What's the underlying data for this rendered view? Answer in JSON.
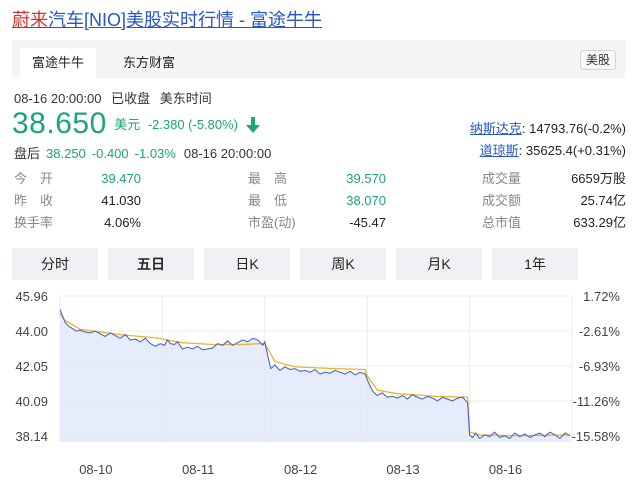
{
  "title": {
    "highlight": "蔚来",
    "rest": "汽车[NIO]美股实时行情 - 富途牛牛"
  },
  "source_tabs": [
    {
      "label": "富途牛牛",
      "active": true
    },
    {
      "label": "东方财富",
      "active": false
    }
  ],
  "market_badge": "美股",
  "meta": {
    "datetime": "08-16 20:00:00",
    "status": "已收盘",
    "timezone": "美东时间"
  },
  "quote": {
    "price": "38.650",
    "currency": "美元",
    "change": "-2.380 (-5.80%)",
    "direction_icon": "arrow-down-icon",
    "color": "#1ba579"
  },
  "after_hours": {
    "label": "盘后",
    "price": "38.250",
    "change": "-0.400",
    "pct": "-1.03%",
    "time": "08-16 20:00:00"
  },
  "indices": [
    {
      "name": "纳斯达克",
      "value": ": 14793.76(-0.2%)"
    },
    {
      "name": "道琼斯",
      "value": ": 35625.4(+0.31%)"
    }
  ],
  "stats": [
    [
      {
        "label": "今　开",
        "value": "39.470",
        "tone": "green"
      },
      {
        "label": "最　高",
        "value": "39.570",
        "tone": "green"
      },
      {
        "label": "成交量",
        "value": "6659万股",
        "tone": "dark"
      }
    ],
    [
      {
        "label": "昨　收",
        "value": "41.030",
        "tone": "dark"
      },
      {
        "label": "最　低",
        "value": "38.070",
        "tone": "green"
      },
      {
        "label": "成交额",
        "value": "25.74亿",
        "tone": "dark"
      }
    ],
    [
      {
        "label": "换手率",
        "value": "4.06%",
        "tone": "dark"
      },
      {
        "label": "市盈(动)",
        "value": "-45.47",
        "tone": "dark"
      },
      {
        "label": "总市值",
        "value": "633.29亿",
        "tone": "dark"
      }
    ]
  ],
  "period_tabs": [
    {
      "label": "分时",
      "active": false
    },
    {
      "label": "五日",
      "active": true
    },
    {
      "label": "日K",
      "active": false
    },
    {
      "label": "周K",
      "active": false
    },
    {
      "label": "月K",
      "active": false
    },
    {
      "label": "1年",
      "active": false
    }
  ],
  "chart_data": {
    "type": "line",
    "title": "",
    "y_ticks": [
      "45.96",
      "44.00",
      "42.05",
      "40.09",
      "38.14"
    ],
    "y_tick_values": [
      45.96,
      44.0,
      42.05,
      40.09,
      38.14
    ],
    "y_pct_ticks": [
      "1.72%",
      "-2.61%",
      "-6.93%",
      "-11.26%",
      "-15.58%"
    ],
    "ylim": [
      37.8,
      45.96
    ],
    "x_ticks": [
      "08-10",
      "08-11",
      "08-12",
      "08-13",
      "08-16"
    ],
    "prev_close": 41.03,
    "grid": true,
    "colors": {
      "price": "#4a68c9",
      "average": "#f2b227",
      "fill": "#dfe6f9"
    },
    "series": [
      {
        "role": "price",
        "day_x": [
          0,
          0.02,
          0.05,
          0.08,
          0.12,
          0.16,
          0.2,
          0.25,
          0.3,
          0.35,
          0.4,
          0.45,
          0.5,
          0.55,
          0.6,
          0.65,
          0.7,
          0.75,
          0.8,
          0.85,
          0.9,
          0.95,
          1,
          1,
          0.02,
          0.05,
          0.08,
          0.12,
          0.15,
          0.2,
          0.25,
          0.3,
          0.35,
          0.4,
          0.45,
          0.5,
          0.55,
          0.6,
          0.65,
          0.7,
          0.75,
          0.8,
          0.85,
          0.9,
          0.95,
          1,
          0,
          0.03,
          0.06,
          0.1,
          0.15,
          0.2,
          0.25,
          0.3,
          0.35,
          0.4,
          0.45,
          0.5,
          0.55,
          0.6,
          0.65,
          0.7,
          0.75,
          0.8,
          0.85,
          0.9,
          0.95,
          1,
          0,
          0.03,
          0.06,
          0.1,
          0.15,
          0.2,
          0.25,
          0.3,
          0.35,
          0.4,
          0.45,
          0.5,
          0.55,
          0.6,
          0.65,
          0.7,
          0.75,
          0.8,
          0.85,
          0.9,
          0.95,
          1,
          0,
          0.03,
          0.06,
          0.1,
          0.15,
          0.2,
          0.25,
          0.3,
          0.35,
          0.4,
          0.45,
          0.5,
          0.55,
          0.6,
          0.65,
          0.7,
          0.75,
          0.8,
          0.85,
          0.9,
          0.95,
          1
        ],
        "day_index": [
          0,
          0,
          0,
          0,
          0,
          0,
          0,
          0,
          0,
          0,
          0,
          0,
          0,
          0,
          0,
          0,
          0,
          0,
          0,
          0,
          0,
          0,
          0,
          0,
          1,
          1,
          1,
          1,
          1,
          1,
          1,
          1,
          1,
          1,
          1,
          1,
          1,
          1,
          1,
          1,
          1,
          1,
          1,
          1,
          1,
          1,
          2,
          2,
          2,
          2,
          2,
          2,
          2,
          2,
          2,
          2,
          2,
          2,
          2,
          2,
          2,
          2,
          2,
          2,
          2,
          2,
          2,
          2,
          3,
          3,
          3,
          3,
          3,
          3,
          3,
          3,
          3,
          3,
          3,
          3,
          3,
          3,
          3,
          3,
          3,
          3,
          3,
          3,
          3,
          3,
          4,
          4,
          4,
          4,
          4,
          4,
          4,
          4,
          4,
          4,
          4,
          4,
          4,
          4,
          4,
          4,
          4,
          4,
          4,
          4,
          4,
          4
        ],
        "values": [
          45.2,
          44.9,
          44.5,
          44.3,
          44.15,
          44.0,
          44.05,
          43.95,
          43.9,
          44.0,
          43.85,
          43.7,
          43.9,
          43.75,
          43.6,
          43.8,
          43.5,
          43.55,
          43.4,
          43.6,
          43.3,
          43.15,
          43.3,
          43.3,
          43.2,
          43.5,
          43.3,
          43.25,
          43.4,
          43.0,
          43.1,
          43.0,
          43.15,
          42.95,
          43.0,
          43.05,
          43.3,
          43.2,
          43.45,
          43.2,
          43.35,
          43.5,
          43.4,
          43.6,
          43.5,
          43.2,
          43.4,
          42.6,
          41.9,
          42.1,
          41.8,
          42.0,
          41.85,
          41.9,
          41.75,
          41.8,
          41.7,
          41.85,
          41.6,
          41.7,
          41.65,
          41.8,
          41.7,
          41.6,
          41.75,
          41.55,
          41.7,
          41.6,
          41.3,
          40.9,
          40.6,
          40.4,
          40.55,
          40.3,
          40.35,
          40.25,
          40.4,
          40.2,
          40.45,
          40.3,
          40.2,
          40.35,
          40.25,
          40.1,
          40.3,
          40.2,
          40.1,
          40.25,
          40.3,
          40.0,
          38.2,
          38.05,
          38.3,
          38.0,
          38.2,
          38.1,
          38.35,
          38.05,
          38.15,
          38.0,
          38.3,
          38.1,
          38.25,
          38.05,
          38.2,
          38.3,
          38.1,
          38.35,
          38.2,
          38.0,
          38.3,
          38.15
        ]
      },
      {
        "role": "average",
        "day_index": [
          0,
          0,
          0,
          0,
          0,
          1,
          1,
          1,
          1,
          1,
          2,
          2,
          2,
          2,
          2,
          3,
          3,
          3,
          3,
          3,
          4,
          4,
          4,
          4
        ],
        "day_x": [
          0,
          0.05,
          0.2,
          0.6,
          1,
          0,
          0.2,
          0.5,
          0.8,
          1,
          0,
          0.1,
          0.3,
          0.7,
          1,
          0,
          0.1,
          0.3,
          0.7,
          1,
          0,
          0.1,
          0.5,
          1
        ],
        "values": [
          45.0,
          44.6,
          44.1,
          43.8,
          43.6,
          43.55,
          43.35,
          43.25,
          43.25,
          43.3,
          43.3,
          42.3,
          42.0,
          41.9,
          41.85,
          41.5,
          40.7,
          40.5,
          40.35,
          40.3,
          38.35,
          38.2,
          38.15,
          38.2
        ]
      }
    ]
  }
}
